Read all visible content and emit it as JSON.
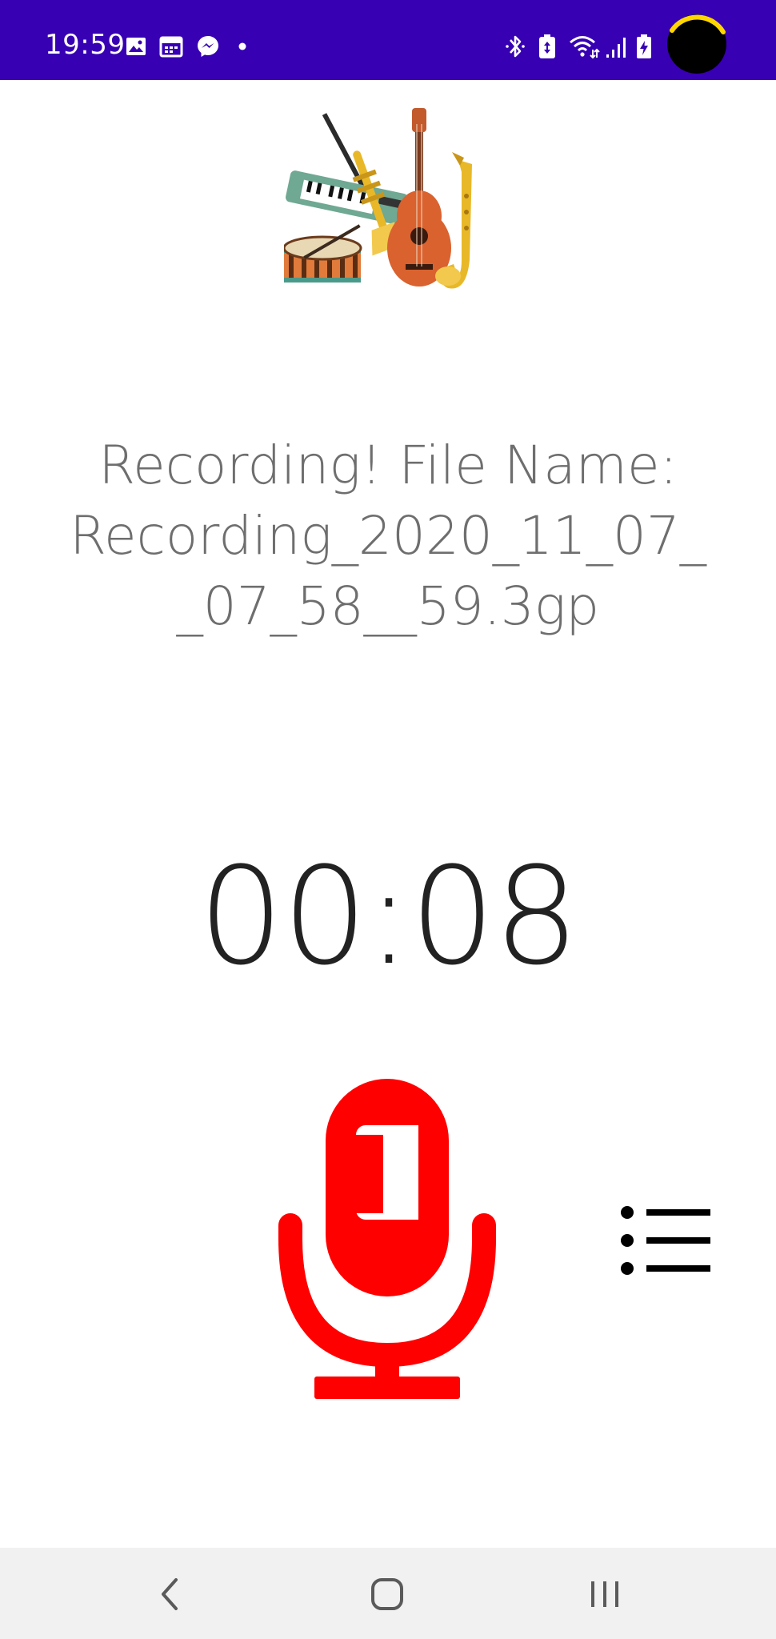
{
  "status_bar": {
    "time": "19:59",
    "background_color": "#3700b3",
    "left_icons": [
      "image-icon",
      "calendar-icon",
      "messenger-icon",
      "dot-icon"
    ],
    "right_icons": [
      "bluetooth-icon",
      "battery-saver-icon",
      "wifi-icon",
      "signal-icon",
      "battery-charging-icon"
    ]
  },
  "logo": {
    "icon": "music-instruments-logo"
  },
  "recording": {
    "line1": "Recording! File Name:",
    "line2": "Recording_2020_11_07_",
    "line3": "_07_58__59.3gp"
  },
  "timer": {
    "value": "00:08"
  },
  "controls": {
    "mic_icon": "microphone-icon",
    "mic_color": "#ff0000",
    "list_icon": "list-icon"
  },
  "nav_bar": {
    "buttons": [
      "back-icon",
      "home-icon",
      "recents-icon"
    ]
  }
}
